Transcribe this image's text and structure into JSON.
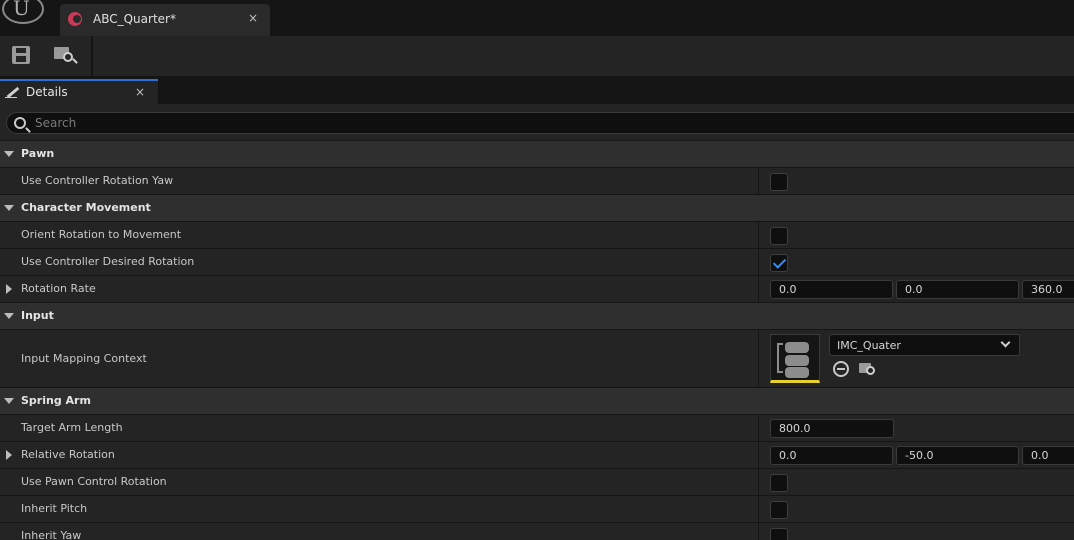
{
  "titlebar": {
    "tab_title": "ABC_Quarter*",
    "tab_close": "×",
    "logo": "U"
  },
  "toolbar": {
    "save_icon": "save-icon",
    "browse_icon": "browse-icon"
  },
  "details_tab": {
    "label": "Details",
    "close": "×"
  },
  "search": {
    "placeholder": "Search"
  },
  "categories": {
    "pawn": "Pawn",
    "character_movement": "Character Movement",
    "input": "Input",
    "spring_arm": "Spring Arm"
  },
  "properties": {
    "use_controller_rotation_yaw": {
      "label": "Use Controller Rotation Yaw",
      "checked": false
    },
    "orient_rotation_to_movement": {
      "label": "Orient Rotation to Movement",
      "checked": false
    },
    "use_controller_desired_rotation": {
      "label": "Use Controller Desired Rotation",
      "checked": true
    },
    "rotation_rate": {
      "label": "Rotation Rate",
      "values": [
        "0.0",
        "0.0",
        "360.0"
      ]
    },
    "input_mapping_context": {
      "label": "Input Mapping Context",
      "value": "IMC_Quater"
    },
    "target_arm_length": {
      "label": "Target Arm Length",
      "value": "800.0"
    },
    "relative_rotation": {
      "label": "Relative Rotation",
      "values": [
        "0.0",
        "-50.0",
        "0.0"
      ]
    },
    "use_pawn_control_rotation": {
      "label": "Use Pawn Control Rotation",
      "checked": false
    },
    "inherit_pitch": {
      "label": "Inherit Pitch",
      "checked": false
    },
    "inherit_yaw": {
      "label": "Inherit Yaw",
      "checked": false
    }
  },
  "colors": {
    "accent_blue": "#2a6fd6",
    "checkmark": "#2f8cff",
    "asset_underline": "#e6d12f",
    "blueprint_icon": "#c83a56"
  }
}
